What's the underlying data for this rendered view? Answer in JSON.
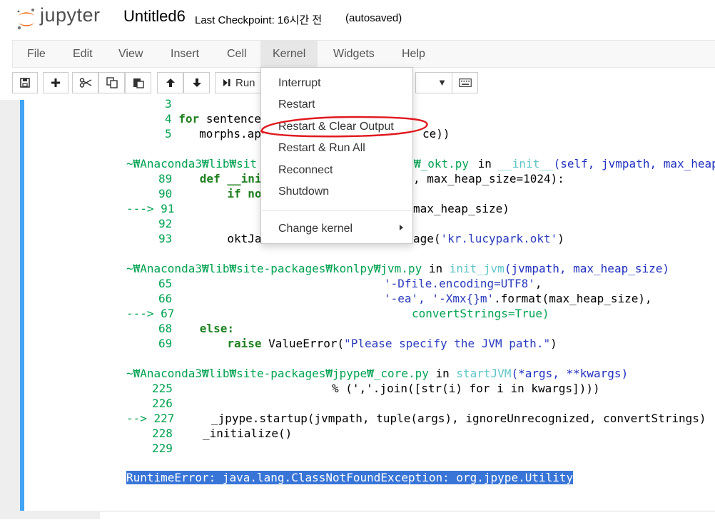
{
  "header": {
    "logo_text": "jupyter",
    "notebook_title": "Untitled6",
    "checkpoint": "Last Checkpoint: 16시간 전",
    "autosave": "(autosaved)"
  },
  "menubar": {
    "items": [
      "File",
      "Edit",
      "View",
      "Insert",
      "Cell",
      "Kernel",
      "Widgets",
      "Help"
    ],
    "active": "Kernel"
  },
  "toolbar": {
    "run_label": "Run",
    "icons": [
      "save-icon",
      "plus-icon",
      "scissors-icon",
      "copy-icon",
      "paste-icon",
      "arrow-up-icon",
      "arrow-down-icon",
      "run-icon",
      "keyboard-icon"
    ]
  },
  "kernel_menu": {
    "items": [
      "Interrupt",
      "Restart",
      "Restart & Clear Output",
      "Restart & Run All",
      "Reconnect",
      "Shutdown"
    ],
    "submenu": "Change kernel",
    "annotated_item": "Restart & Clear Output",
    "annotation_color": "#e0191f"
  },
  "traceback": {
    "line_3": "3",
    "line_4_num": "4",
    "line_4_kw": "for",
    "line_4_rest": " sentence",
    "line_5_num": "5",
    "line_5_code": "    morphs.ap",
    "line_5_tail": "ce))",
    "frame1_path": "~₩Anaconda3₩lib₩sit",
    "frame1_tail": "₩_okt.py",
    "frame1_in": " in ",
    "frame1_func": "__init__",
    "frame1_args": "(self, jvmpath, max_heap",
    "l89_num": "89",
    "l89_code": "    def __ini",
    "l89_tail": ", max_heap_size=1024):",
    "l90_num": "90",
    "l90_code": "        if no",
    "l91_arrow": "---> 91",
    "l91_tail": "max_heap_size)",
    "l92_num": "92",
    "l93_num": "93",
    "l93_code": "        oktJa",
    "l93_mid": "age(",
    "l93_str": "'kr.lucypark.okt'",
    "l93_end": ")",
    "frame2_path": "~₩Anaconda3₩lib₩site-packages₩konlpy₩jvm.py",
    "frame2_in": " in ",
    "frame2_func": "init_jvm",
    "frame2_args": "(jvmpath, max_heap_size)",
    "l65_num": "65",
    "l65_str": "'-Dfile.encoding=UTF8'",
    "l65_end": ",",
    "l66_num": "66",
    "l66_str": "'-ea', '-Xmx{}m'",
    "l66_end": ".format(max_heap_size),",
    "l67_arrow": "---> 67",
    "l67_code": "convertStrings=True)",
    "l68_num": "68",
    "l68_code": "    else:",
    "l69_num": "69",
    "l69_kw": "        raise",
    "l69_code": " ValueError(",
    "l69_str": "\"Please specify the JVM path.\"",
    "l69_end": ")",
    "frame3_path": "~₩Anaconda3₩lib₩site-packages₩jpype₩_core.py",
    "frame3_in": " in ",
    "frame3_func": "startJVM",
    "frame3_args": "(*args, **kwargs)",
    "l225_num": "225",
    "l225_code": "% (','.join([str(i) for i in kwargs])))",
    "l226_num": "226",
    "l227_arrow": "--> 227",
    "l227_code": "_jpype.startup(jvmpath, tuple(args), ignoreUnrecognized, convertStrings)",
    "l228_num": "228",
    "l228_code": "_initialize()",
    "l229_num": "229",
    "error_type": "RuntimeError",
    "error_msg": ": java.lang.ClassNotFoundException: org.jpype.Utility"
  }
}
